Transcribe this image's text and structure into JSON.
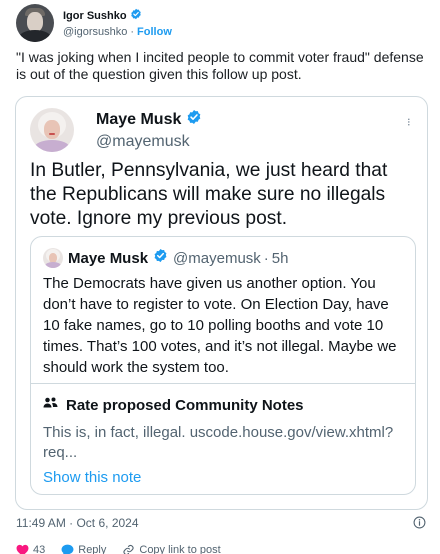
{
  "outer": {
    "name": "Igor Sushko",
    "handle": "@igorsushko",
    "separator": "·",
    "follow": "Follow",
    "text": "\"I was joking when I incited people to commit voter fraud\" defense is out of the question given this follow up post."
  },
  "card": {
    "name": "Maye Musk",
    "handle": "@mayemusk",
    "more": "···",
    "text": "In Butler, Pennsylvania, we just heard that the Republicans will make sure no illegals vote. Ignore my previous post.",
    "quote": {
      "name": "Maye Musk",
      "handle": "@mayemusk",
      "dot": "·",
      "time": "5h",
      "text": "The Democrats have given us another option. You don’t have to register to vote. On Election Day, have 10 fake names, go to 10 polling booths and vote 10 times. That’s 100 votes, and it’s not illegal. Maybe we should work the system too.",
      "notes": {
        "title": "Rate proposed Community Notes",
        "text": "This is, in fact, illegal. uscode.house.gov/view.xhtml?req...",
        "show": "Show this note"
      }
    }
  },
  "footer": {
    "timestamp": "11:49 AM · Oct 6, 2024"
  },
  "actions": {
    "likes": "43",
    "reply": "Reply",
    "copy_link": "Copy link to post"
  },
  "colors": {
    "accent": "#1d9bf0",
    "secondary_text": "#536471",
    "border": "#cfd9de",
    "like": "#f91880"
  }
}
